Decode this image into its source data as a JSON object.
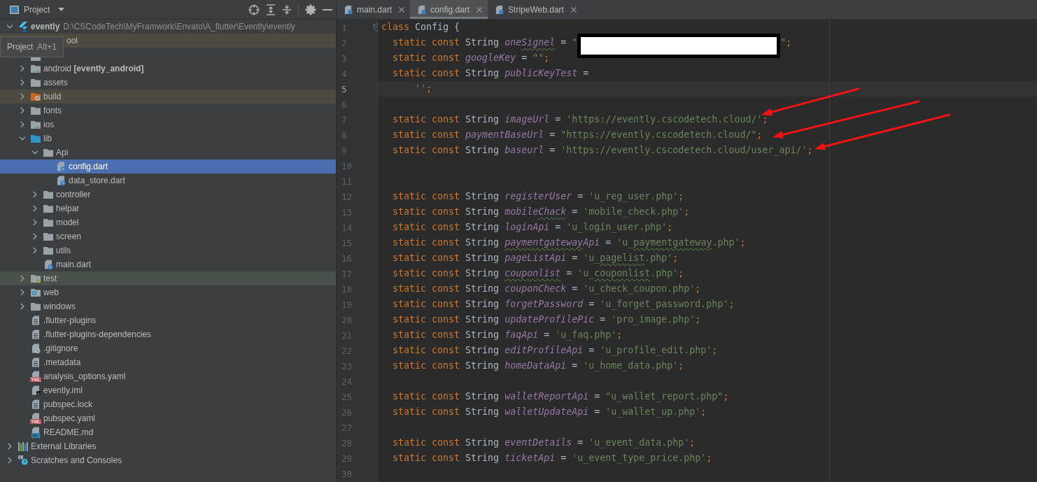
{
  "project_panel": {
    "title": "Project",
    "tooltip": {
      "title": "Project",
      "shortcut": "Alt+1"
    },
    "tree": [
      {
        "label": "evently",
        "kind": "flutter_project",
        "path": "D:\\CSCodeTech\\MyFramwork\\Envato\\A_flutter\\Evently\\evently",
        "expanded": true,
        "selected": false,
        "children": [
          {
            "label": "ool",
            "kind": "excluded_folder",
            "covered": true,
            "selected": false
          },
          {
            "kind": "folder",
            "covered": true,
            "selected": false
          },
          {
            "label": "android **[evently_android]**",
            "kind": "module_folder",
            "expanded": false,
            "selected": false
          },
          {
            "label": "assets",
            "kind": "folder",
            "expanded": false,
            "selected": false
          },
          {
            "label": "build",
            "kind": "excluded_folder",
            "expanded": false,
            "selected": false
          },
          {
            "label": "fonts",
            "kind": "folder",
            "expanded": false,
            "selected": false
          },
          {
            "label": "ios",
            "kind": "module_folder",
            "expanded": false,
            "selected": false
          },
          {
            "label": "lib",
            "kind": "source_folder",
            "expanded": true,
            "selected": false,
            "children": [
              {
                "label": "Api",
                "kind": "folder",
                "expanded": true,
                "selected": false,
                "children": [
                  {
                    "label": "config.dart",
                    "kind": "dart_file",
                    "selected": true
                  },
                  {
                    "label": "data_store.dart",
                    "kind": "dart_file",
                    "selected": false
                  }
                ]
              },
              {
                "label": "controller",
                "kind": "folder",
                "expanded": false,
                "selected": false
              },
              {
                "label": "helpar",
                "kind": "folder",
                "expanded": false,
                "selected": false
              },
              {
                "label": "model",
                "kind": "folder",
                "expanded": false,
                "selected": false
              },
              {
                "label": "screen",
                "kind": "folder",
                "expanded": false,
                "selected": false
              },
              {
                "label": "utils",
                "kind": "folder",
                "expanded": false,
                "selected": false
              },
              {
                "label": "main.dart",
                "kind": "dart_file",
                "selected": false
              }
            ]
          },
          {
            "label": "test",
            "kind": "test_folder",
            "expanded": false,
            "selected": false
          },
          {
            "label": "web",
            "kind": "web_folder",
            "expanded": false,
            "selected": false
          },
          {
            "label": "windows",
            "kind": "folder",
            "expanded": false,
            "selected": false
          },
          {
            "label": ".flutter-plugins",
            "kind": "text_file",
            "selected": false
          },
          {
            "label": ".flutter-plugins-dependencies",
            "kind": "text_file",
            "selected": false
          },
          {
            "label": ".gitignore",
            "kind": "ignore_file",
            "selected": false
          },
          {
            "label": ".metadata",
            "kind": "text_file",
            "selected": false
          },
          {
            "label": "analysis_options.yaml",
            "kind": "yaml_file",
            "badge": "YML",
            "selected": false
          },
          {
            "label": "evently.iml",
            "kind": "iml_file",
            "selected": false
          },
          {
            "label": "pubspec.lock",
            "kind": "text_file",
            "selected": false
          },
          {
            "label": "pubspec.yaml",
            "kind": "yaml_file",
            "badge": "YML",
            "selected": false
          },
          {
            "label": "README.md",
            "kind": "md_file",
            "badge": "MD",
            "selected": false
          }
        ]
      },
      {
        "label": "External Libraries",
        "kind": "libraries",
        "expanded": false,
        "selected": false
      },
      {
        "label": "Scratches and Consoles",
        "kind": "scratches",
        "expanded": false,
        "selected": false
      }
    ]
  },
  "editor": {
    "tabs": [
      {
        "label": "main.dart",
        "selected": false
      },
      {
        "label": "config.dart",
        "selected": true
      },
      {
        "label": "StripeWeb.dart",
        "selected": false
      }
    ],
    "lines": [
      {
        "number": "1",
        "current": false,
        "fold": true,
        "tokens": [
          {
            "kind": "keyword",
            "text": "class "
          },
          {
            "kind": "plain",
            "text": "Config {"
          }
        ]
      },
      {
        "number": "2",
        "current": false,
        "fold": false,
        "tokens": [
          {
            "kind": "keyword",
            "text": "  static const "
          },
          {
            "kind": "plain",
            "text": "String "
          },
          {
            "kind": "field",
            "text": "one"
          },
          {
            "kind": "field",
            "text": "Signel",
            "typo": true
          },
          {
            "kind": "plain",
            "text": " = "
          },
          {
            "kind": "string",
            "text": "\""
          },
          {
            "kind": "redacted"
          },
          {
            "kind": "string",
            "text": "\""
          },
          {
            "kind": "punct",
            "text": ";"
          }
        ]
      },
      {
        "number": "3",
        "current": false,
        "fold": false,
        "tokens": [
          {
            "kind": "keyword",
            "text": "  static const "
          },
          {
            "kind": "field",
            "text": "googleKey"
          },
          {
            "kind": "plain",
            "text": " = "
          },
          {
            "kind": "string",
            "text": "\"\""
          },
          {
            "kind": "punct",
            "text": ";"
          }
        ]
      },
      {
        "number": "4",
        "current": false,
        "fold": false,
        "tokens": [
          {
            "kind": "keyword",
            "text": "  static const "
          },
          {
            "kind": "plain",
            "text": "String "
          },
          {
            "kind": "field",
            "text": "publicKeyTest"
          },
          {
            "kind": "plain",
            "text": " ="
          }
        ]
      },
      {
        "number": "5",
        "current": true,
        "fold": false,
        "tokens": [
          {
            "kind": "string",
            "text": "      ''"
          },
          {
            "kind": "punct",
            "text": ";"
          }
        ]
      },
      {
        "number": "6",
        "current": false,
        "fold": false
      },
      {
        "number": "7",
        "current": false,
        "fold": false,
        "tokens": [
          {
            "kind": "keyword",
            "text": "  static const "
          },
          {
            "kind": "plain",
            "text": "String "
          },
          {
            "kind": "field",
            "text": "imageUrl"
          },
          {
            "kind": "plain",
            "text": " = "
          },
          {
            "kind": "string",
            "text": "'https://evently.cscodetech.cloud/'"
          },
          {
            "kind": "punct",
            "text": ";"
          }
        ]
      },
      {
        "number": "8",
        "current": false,
        "fold": false,
        "tokens": [
          {
            "kind": "keyword",
            "text": "  static const "
          },
          {
            "kind": "field",
            "text": "paymentBaseUrl"
          },
          {
            "kind": "plain",
            "text": " = "
          },
          {
            "kind": "string",
            "text": "\"https://evently.cscodetech.cloud/\""
          },
          {
            "kind": "punct",
            "text": ";"
          }
        ]
      },
      {
        "number": "9",
        "current": false,
        "fold": false,
        "tokens": [
          {
            "kind": "keyword",
            "text": "  static const "
          },
          {
            "kind": "plain",
            "text": "String "
          },
          {
            "kind": "field",
            "text": "baseurl"
          },
          {
            "kind": "plain",
            "text": " = "
          },
          {
            "kind": "string",
            "text": "'https://evently.cscodetech.cloud/user_api/'"
          },
          {
            "kind": "punct",
            "text": ";"
          }
        ]
      },
      {
        "number": "10",
        "current": false,
        "fold": false
      },
      {
        "number": "11",
        "current": false,
        "fold": false
      },
      {
        "number": "12",
        "current": false,
        "fold": false,
        "tokens": [
          {
            "kind": "keyword",
            "text": "  static const "
          },
          {
            "kind": "plain",
            "text": "String "
          },
          {
            "kind": "field",
            "text": "registerUser"
          },
          {
            "kind": "plain",
            "text": " = "
          },
          {
            "kind": "string",
            "text": "'u_reg_user.php'"
          },
          {
            "kind": "punct",
            "text": ";"
          }
        ]
      },
      {
        "number": "13",
        "current": false,
        "fold": false,
        "tokens": [
          {
            "kind": "keyword",
            "text": "  static const "
          },
          {
            "kind": "plain",
            "text": "String "
          },
          {
            "kind": "field",
            "text": "mobile"
          },
          {
            "kind": "field",
            "text": "Chack",
            "typo": true
          },
          {
            "kind": "plain",
            "text": " = "
          },
          {
            "kind": "string",
            "text": "'mobile_check.php'"
          },
          {
            "kind": "punct",
            "text": ";"
          }
        ]
      },
      {
        "number": "14",
        "current": false,
        "fold": false,
        "tokens": [
          {
            "kind": "keyword",
            "text": "  static const "
          },
          {
            "kind": "plain",
            "text": "String "
          },
          {
            "kind": "field",
            "text": "loginApi"
          },
          {
            "kind": "plain",
            "text": " = "
          },
          {
            "kind": "string",
            "text": "'u_login_user.php'"
          },
          {
            "kind": "punct",
            "text": ";"
          }
        ]
      },
      {
        "number": "15",
        "current": false,
        "fold": false,
        "tokens": [
          {
            "kind": "keyword",
            "text": "  static const "
          },
          {
            "kind": "plain",
            "text": "String "
          },
          {
            "kind": "field",
            "text": "paymentgateway",
            "typo": true
          },
          {
            "kind": "field",
            "text": "Api"
          },
          {
            "kind": "plain",
            "text": " = "
          },
          {
            "kind": "string",
            "text": "'u_"
          },
          {
            "kind": "string",
            "text": "paymentgateway",
            "typo": true
          },
          {
            "kind": "string",
            "text": ".php'"
          },
          {
            "kind": "punct",
            "text": ";"
          }
        ]
      },
      {
        "number": "16",
        "current": false,
        "fold": false,
        "tokens": [
          {
            "kind": "keyword",
            "text": "  static const "
          },
          {
            "kind": "plain",
            "text": "String "
          },
          {
            "kind": "field",
            "text": "pageListApi"
          },
          {
            "kind": "plain",
            "text": " = "
          },
          {
            "kind": "string",
            "text": "'u_"
          },
          {
            "kind": "string",
            "text": "pagelist",
            "typo": true
          },
          {
            "kind": "string",
            "text": ".php'"
          },
          {
            "kind": "punct",
            "text": ";"
          }
        ]
      },
      {
        "number": "17",
        "current": false,
        "fold": false,
        "tokens": [
          {
            "kind": "keyword",
            "text": "  static const "
          },
          {
            "kind": "plain",
            "text": "String "
          },
          {
            "kind": "field",
            "text": "couponlist",
            "typo": true
          },
          {
            "kind": "plain",
            "text": " = "
          },
          {
            "kind": "string",
            "text": "'u_"
          },
          {
            "kind": "string",
            "text": "couponlist",
            "typo": true
          },
          {
            "kind": "string",
            "text": ".php'"
          },
          {
            "kind": "punct",
            "text": ";"
          }
        ]
      },
      {
        "number": "18",
        "current": false,
        "fold": false,
        "tokens": [
          {
            "kind": "keyword",
            "text": "  static const "
          },
          {
            "kind": "plain",
            "text": "String "
          },
          {
            "kind": "field",
            "text": "couponCheck"
          },
          {
            "kind": "plain",
            "text": " = "
          },
          {
            "kind": "string",
            "text": "'u_check_coupon.php'"
          },
          {
            "kind": "punct",
            "text": ";"
          }
        ]
      },
      {
        "number": "19",
        "current": false,
        "fold": false,
        "tokens": [
          {
            "kind": "keyword",
            "text": "  static const "
          },
          {
            "kind": "plain",
            "text": "String "
          },
          {
            "kind": "field",
            "text": "forgetPassword"
          },
          {
            "kind": "plain",
            "text": " = "
          },
          {
            "kind": "string",
            "text": "'u_forget_password.php'"
          },
          {
            "kind": "punct",
            "text": ";"
          }
        ]
      },
      {
        "number": "20",
        "current": false,
        "fold": false,
        "tokens": [
          {
            "kind": "keyword",
            "text": "  static const "
          },
          {
            "kind": "plain",
            "text": "String "
          },
          {
            "kind": "field",
            "text": "updateProfilePic"
          },
          {
            "kind": "plain",
            "text": " = "
          },
          {
            "kind": "string",
            "text": "'pro_image.php'"
          },
          {
            "kind": "punct",
            "text": ";"
          }
        ]
      },
      {
        "number": "21",
        "current": false,
        "fold": false,
        "tokens": [
          {
            "kind": "keyword",
            "text": "  static const "
          },
          {
            "kind": "plain",
            "text": "String "
          },
          {
            "kind": "field",
            "text": "faqApi"
          },
          {
            "kind": "plain",
            "text": " = "
          },
          {
            "kind": "string",
            "text": "'u_faq.php'"
          },
          {
            "kind": "punct",
            "text": ";"
          }
        ]
      },
      {
        "number": "22",
        "current": false,
        "fold": false,
        "tokens": [
          {
            "kind": "keyword",
            "text": "  static const "
          },
          {
            "kind": "plain",
            "text": "String "
          },
          {
            "kind": "field",
            "text": "editProfileApi"
          },
          {
            "kind": "plain",
            "text": " = "
          },
          {
            "kind": "string",
            "text": "'u_profile_edit.php'"
          },
          {
            "kind": "punct",
            "text": ";"
          }
        ]
      },
      {
        "number": "23",
        "current": false,
        "fold": false,
        "tokens": [
          {
            "kind": "keyword",
            "text": "  static const "
          },
          {
            "kind": "plain",
            "text": "String "
          },
          {
            "kind": "field",
            "text": "homeDataApi"
          },
          {
            "kind": "plain",
            "text": " = "
          },
          {
            "kind": "string",
            "text": "'u_home_data.php'"
          },
          {
            "kind": "punct",
            "text": ";"
          }
        ]
      },
      {
        "number": "24",
        "current": false,
        "fold": false
      },
      {
        "number": "25",
        "current": false,
        "fold": false,
        "tokens": [
          {
            "kind": "keyword",
            "text": "  static const "
          },
          {
            "kind": "plain",
            "text": "String "
          },
          {
            "kind": "field",
            "text": "walletReportApi"
          },
          {
            "kind": "plain",
            "text": " = "
          },
          {
            "kind": "string",
            "text": "\"u_wallet_report.php\""
          },
          {
            "kind": "punct",
            "text": ";"
          }
        ]
      },
      {
        "number": "26",
        "current": false,
        "fold": false,
        "tokens": [
          {
            "kind": "keyword",
            "text": "  static const "
          },
          {
            "kind": "plain",
            "text": "String "
          },
          {
            "kind": "field",
            "text": "walletUpdateApi"
          },
          {
            "kind": "plain",
            "text": " = "
          },
          {
            "kind": "string",
            "text": "'u_wallet_up.php'"
          },
          {
            "kind": "punct",
            "text": ";"
          }
        ]
      },
      {
        "number": "27",
        "current": false,
        "fold": false
      },
      {
        "number": "28",
        "current": false,
        "fold": false,
        "tokens": [
          {
            "kind": "keyword",
            "text": "  static const "
          },
          {
            "kind": "plain",
            "text": "String "
          },
          {
            "kind": "field",
            "text": "eventDetails"
          },
          {
            "kind": "plain",
            "text": " = "
          },
          {
            "kind": "string",
            "text": "'u_event_data.php'"
          },
          {
            "kind": "punct",
            "text": ";"
          }
        ]
      },
      {
        "number": "29",
        "current": false,
        "fold": false,
        "tokens": [
          {
            "kind": "keyword",
            "text": "  static const "
          },
          {
            "kind": "plain",
            "text": "String "
          },
          {
            "kind": "field",
            "text": "ticketApi"
          },
          {
            "kind": "plain",
            "text": " = "
          },
          {
            "kind": "string",
            "text": "'u_event_type_price.php'"
          },
          {
            "kind": "punct",
            "text": ";"
          }
        ]
      },
      {
        "number": "30",
        "current": false,
        "fold": false
      }
    ],
    "annotations": [
      {
        "kind": "arrow"
      },
      {
        "kind": "arrow"
      },
      {
        "kind": "arrow"
      }
    ]
  }
}
